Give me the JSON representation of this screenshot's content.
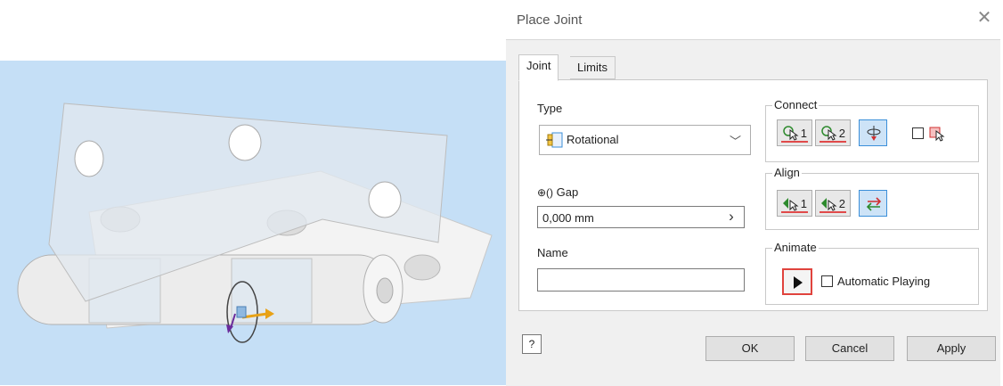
{
  "dialog": {
    "title": "Place Joint",
    "close_glyph": "✕",
    "tabs": [
      "Joint",
      "Limits"
    ],
    "type_label": "Type",
    "type_value": "Rotational",
    "type_icon": "rotational-joint-icon",
    "gap_label": "Gap",
    "gap_value": "0,000 mm",
    "gap_stepper_glyph": "›",
    "name_label": "Name",
    "name_value": "",
    "connect_label": "Connect",
    "connect_buttons": [
      "1",
      "2"
    ],
    "align_label": "Align",
    "align_buttons": [
      "1",
      "2"
    ],
    "animate_label": "Animate",
    "automatic_playing_label": "Automatic Playing",
    "help_glyph": "?",
    "ok_label": "OK",
    "cancel_label": "Cancel",
    "apply_label": "Apply",
    "colors": {
      "accent_blue": "#3b8fd9",
      "highlight_red": "#e0433d",
      "viewport_bg": "#c5dff6"
    }
  }
}
